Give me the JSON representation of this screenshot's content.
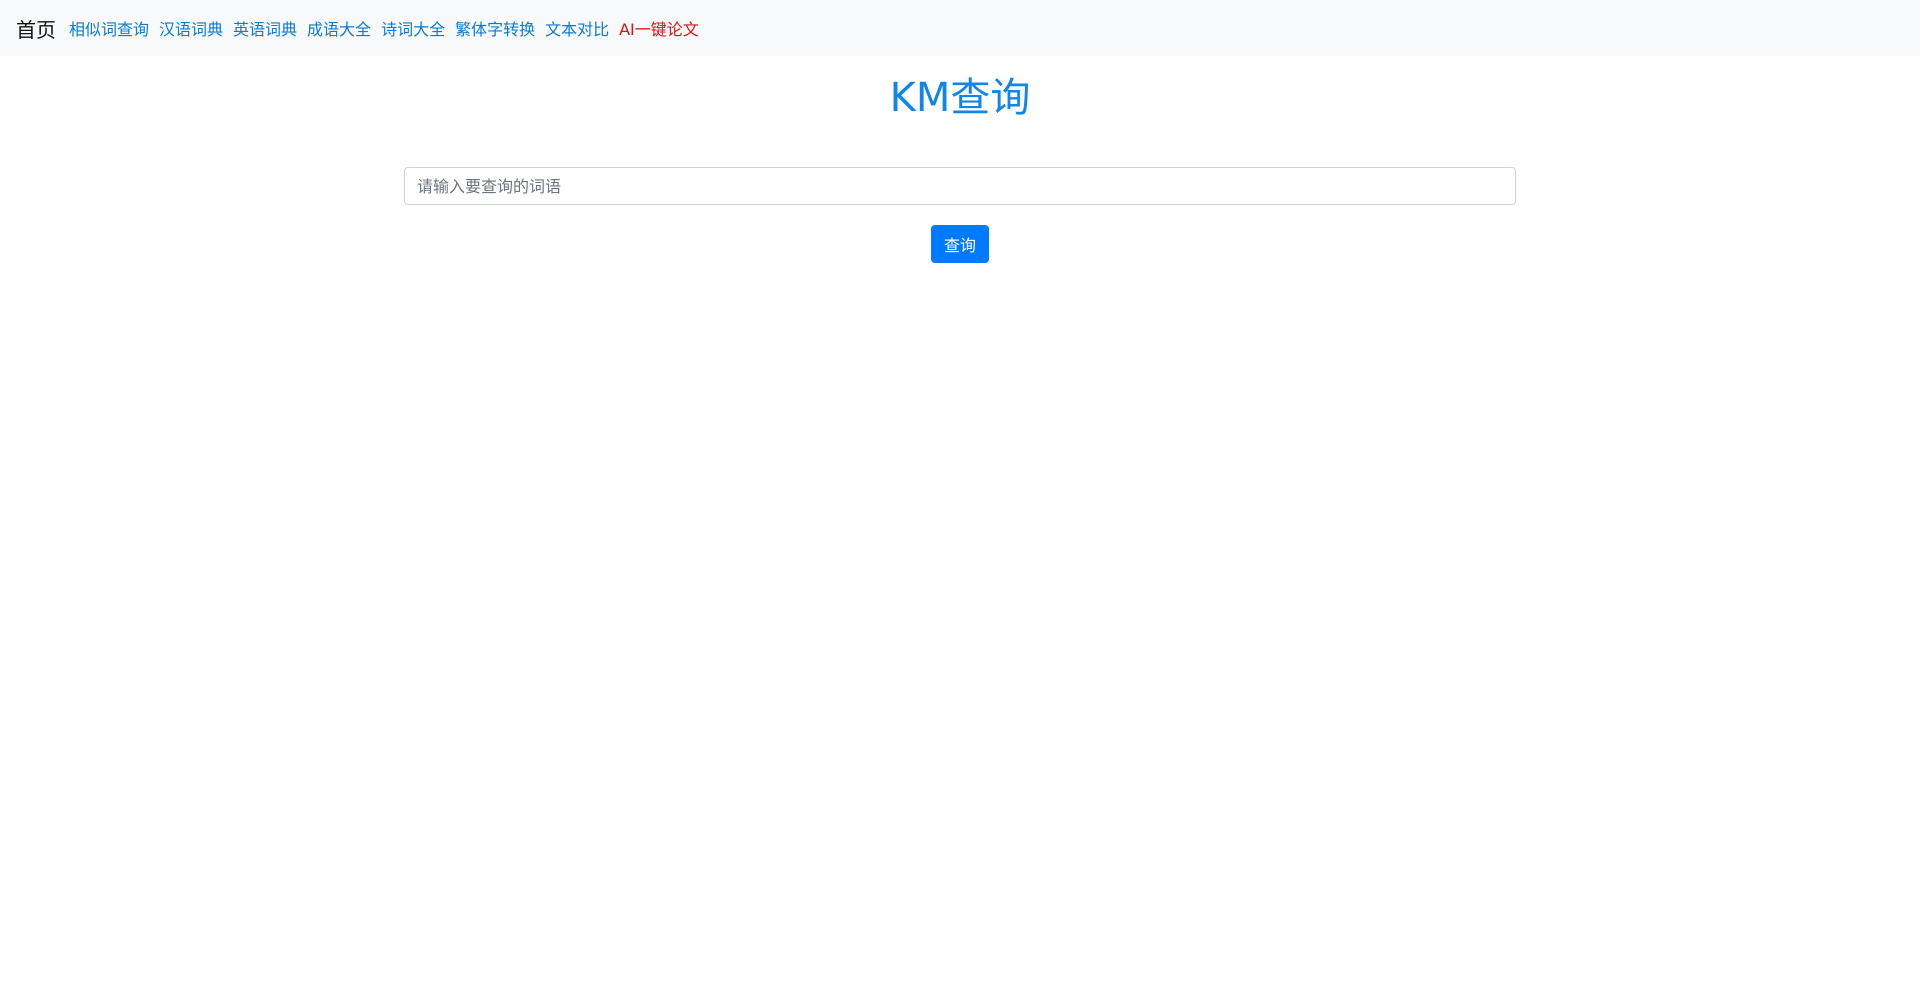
{
  "navbar": {
    "brand": "首页",
    "links": [
      {
        "label": "相似词查询"
      },
      {
        "label": "汉语词典"
      },
      {
        "label": "英语词典"
      },
      {
        "label": "成语大全"
      },
      {
        "label": "诗词大全"
      },
      {
        "label": "繁体字转换"
      },
      {
        "label": "文本对比"
      },
      {
        "label": "AI一键论文"
      }
    ]
  },
  "main": {
    "title": "KM查询",
    "search": {
      "placeholder": "请输入要查询的词语",
      "value": ""
    },
    "button_label": "查询"
  },
  "colors": {
    "link": "#0a7bd6",
    "highlight_link": "#d9120f",
    "title": "#1286e8",
    "button": "#007bff",
    "navbar_bg": "#f8f9fa"
  }
}
